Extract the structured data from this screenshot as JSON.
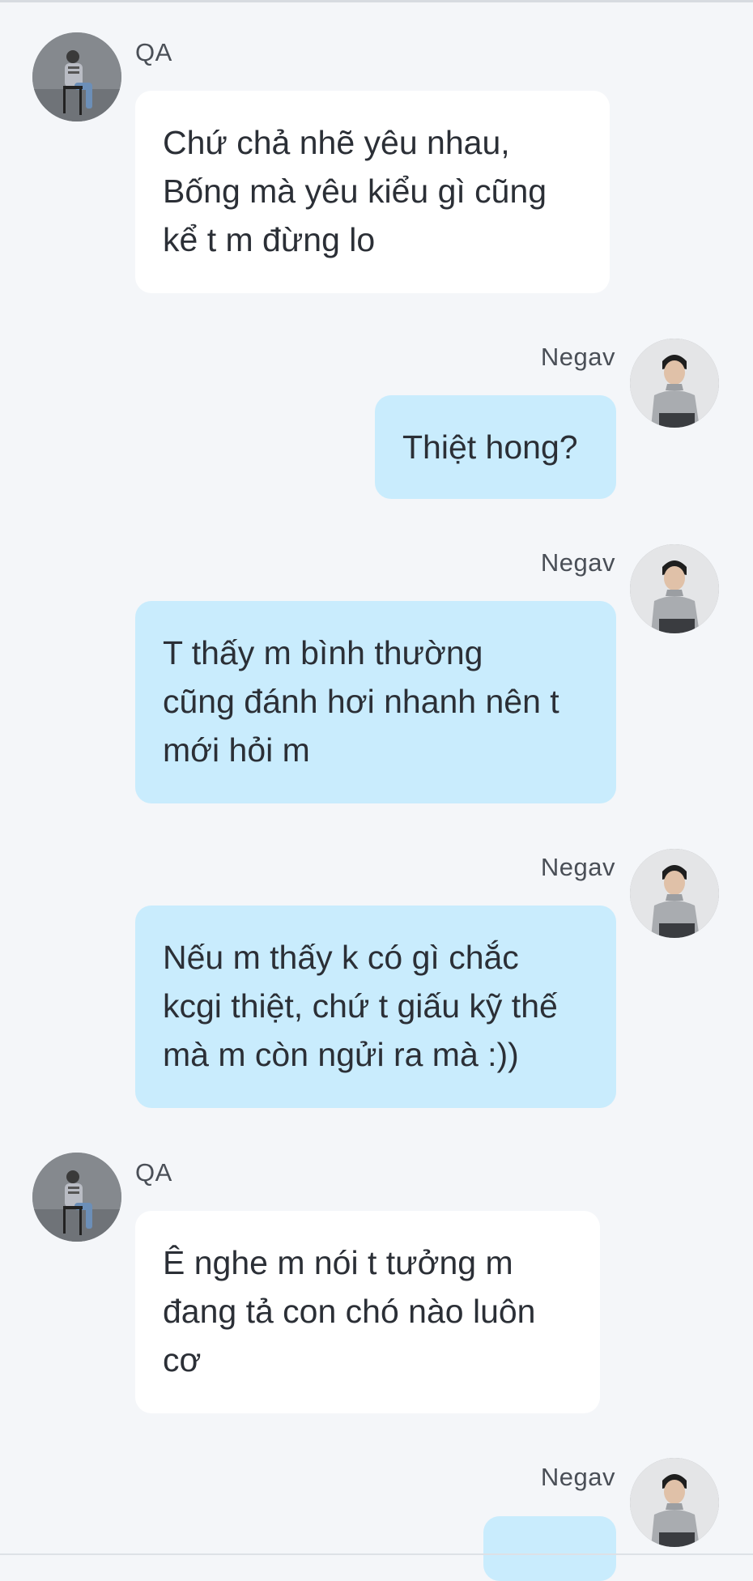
{
  "messages": [
    {
      "sender": "QA",
      "direction": "received",
      "avatar": "qa-avatar",
      "lines": [
        "Chứ chả nhẽ yêu nhau,",
        "Bống mà yêu kiểu gì cũng",
        "kể t m đừng lo"
      ]
    },
    {
      "sender": "Negav",
      "direction": "sent",
      "avatar": "negav-avatar",
      "lines": [
        "Thiệt hong?"
      ]
    },
    {
      "sender": "Negav",
      "direction": "sent",
      "avatar": "negav-avatar",
      "lines": [
        "T thấy m bình thường",
        "cũng đánh hơi nhanh nên t",
        "mới hỏi m"
      ]
    },
    {
      "sender": "Negav",
      "direction": "sent",
      "avatar": "negav-avatar",
      "lines": [
        "Nếu m thấy k có gì chắc",
        "kcgi thiệt, chứ t giấu kỹ thế",
        "mà m còn ngửi ra mà :))"
      ]
    },
    {
      "sender": "QA",
      "direction": "received",
      "avatar": "qa-avatar",
      "lines": [
        "Ê nghe m nói t tưởng m",
        "đang tả con chó nào luôn",
        "cơ"
      ]
    },
    {
      "sender": "Negav",
      "direction": "sent",
      "avatar": "negav-avatar",
      "lines": []
    }
  ],
  "colors": {
    "background": "#f4f6f9",
    "received_bubble": "#ffffff",
    "sent_bubble": "#c9ecfd",
    "text": "#2b2f36",
    "name": "#4a4f57"
  }
}
